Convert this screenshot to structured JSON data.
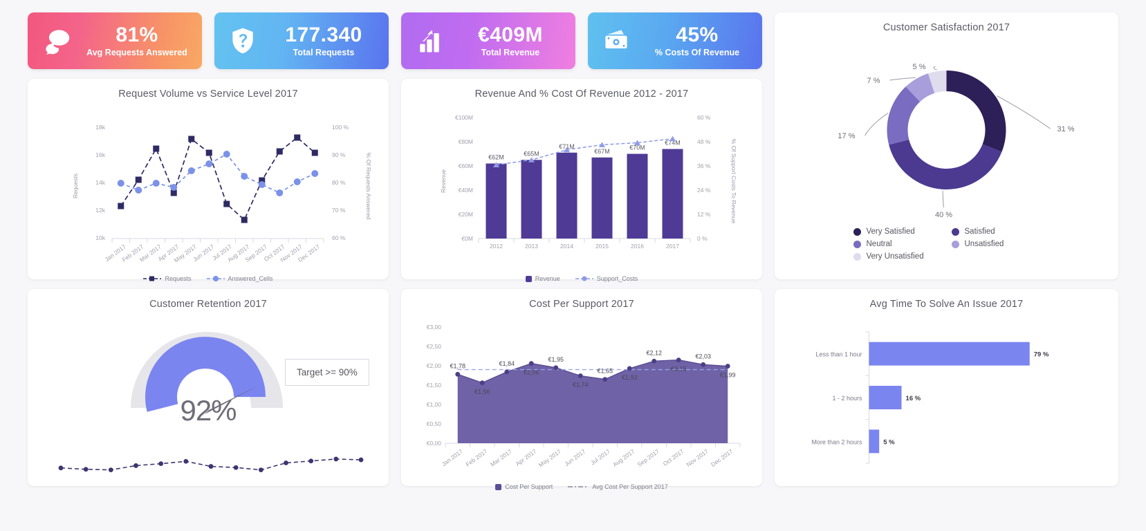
{
  "kpis": [
    {
      "icon": "chat-bubbles-icon",
      "value": "81%",
      "label": "Avg Requests Answered"
    },
    {
      "icon": "shield-question-icon",
      "value": "177.340",
      "label": "Total Requests"
    },
    {
      "icon": "bar-chart-up-icon",
      "value": "€409M",
      "label": "Total Revenue"
    },
    {
      "icon": "money-banknote-icon",
      "value": "45%",
      "label": "% Costs Of Revenue"
    }
  ],
  "chart_data": [
    {
      "id": "request_volume",
      "type": "line",
      "title": "Request Volume vs Service Level 2017",
      "xlabel": "",
      "ylabel": "Requests",
      "y2label": "% Of Requests Answered",
      "categories": [
        "Jan 2017",
        "Feb 2017",
        "Mar 2017",
        "Apr 2017",
        "May 2017",
        "Jun 2017",
        "Jul 2017",
        "Aug 2017",
        "Sep 2017",
        "Oct 2017",
        "Nov 2017",
        "Dec 2017"
      ],
      "ytick_labels": [
        "10k",
        "12k",
        "14k",
        "16k",
        "18k"
      ],
      "ylim": [
        10000,
        18000
      ],
      "y2tick_labels": [
        "60 %",
        "70 %",
        "80 %",
        "90 %",
        "100 %"
      ],
      "y2lim": [
        60,
        100
      ],
      "grid": false,
      "legend_position": "bottom",
      "series": [
        {
          "name": "Requests",
          "axis": "left",
          "color": "#2e2a63",
          "values": [
            12350,
            14250,
            16500,
            13300,
            17200,
            16200,
            12500,
            11350,
            14200,
            16300,
            17300,
            16200
          ]
        },
        {
          "name": "Answered_Cells",
          "axis": "right",
          "color": "#7b92e8",
          "values": [
            80.0,
            77.5,
            80.0,
            78.5,
            84.5,
            87.0,
            90.5,
            82.5,
            79.5,
            76.5,
            80.5,
            83.5
          ]
        }
      ]
    },
    {
      "id": "revenue_cost",
      "type": "bar",
      "title": "Revenue And % Cost Of Revenue 2012 - 2017",
      "ylabel": "Revenue",
      "y2label": "% Of Support Costs To Revenue",
      "categories": [
        "2012",
        "2013",
        "2014",
        "2015",
        "2016",
        "2017"
      ],
      "ytick_labels": [
        "€0M",
        "€20M",
        "€40M",
        "€60M",
        "€80M",
        "€100M"
      ],
      "ylim": [
        0,
        100
      ],
      "y2tick_labels": [
        "0 %",
        "12 %",
        "24 %",
        "36 %",
        "48 %",
        "60 %"
      ],
      "y2lim": [
        0,
        60
      ],
      "legend_position": "bottom",
      "series": [
        {
          "name": "Revenue",
          "type": "bar",
          "color": "#4f3a96",
          "values": [
            62,
            65,
            71,
            67,
            70,
            74
          ],
          "labels": [
            "€62M",
            "€65M",
            "€71M",
            "€67M",
            "€70M",
            "€74M"
          ]
        },
        {
          "name": "Support_Costs",
          "type": "line",
          "axis": "right",
          "color": "#8f9ae8",
          "values": [
            36.5,
            39.0,
            44.0,
            46.5,
            47.5,
            49.5
          ]
        }
      ]
    },
    {
      "id": "customer_satisfaction",
      "type": "pie",
      "title": "Customer Satisfaction 2017",
      "labels": [
        "Very Satisfied",
        "Satisfied",
        "Neutral",
        "Unsatisfied",
        "Very Unsatisfied"
      ],
      "values": [
        31,
        40,
        17,
        7,
        5
      ],
      "value_labels": [
        "31 %",
        "40 %",
        "17 %",
        "7 %",
        "5 %"
      ],
      "colors": [
        "#2d1f57",
        "#4b3a90",
        "#7a6cc0",
        "#a79edb",
        "#dedced"
      ],
      "legend_position": "bottom"
    },
    {
      "id": "customer_retention",
      "type": "gauge",
      "title": "Customer Retention 2017",
      "value": 92,
      "value_label": "92%",
      "target_label": "Target >=  90%",
      "gauge_color": "#7b85f0",
      "gauge_track_color": "#e6e6ea",
      "spark_label": "",
      "spark_values": [
        40,
        33,
        30,
        52,
        62,
        74,
        48,
        42,
        30,
        66,
        76,
        86,
        82
      ],
      "spark_color": "#3d3570"
    },
    {
      "id": "cost_per_support",
      "type": "area",
      "title": "Cost Per Support 2017",
      "categories": [
        "Jan 2017",
        "Feb 2017",
        "Mar 2017",
        "Apr 2017",
        "May 2017",
        "Jun 2017",
        "Jul 2017",
        "Aug 2017",
        "Sep 2017",
        "Oct 2017",
        "Nov 2017",
        "Dec 2017"
      ],
      "ytick_labels": [
        "€0,00",
        "€0,50",
        "€1,00",
        "€1,50",
        "€2,00",
        "€2,50",
        "€3,00"
      ],
      "ylim": [
        0,
        3
      ],
      "legend_position": "bottom",
      "series": [
        {
          "name": "Cost Per Support",
          "type": "area",
          "color": "#6f62a6",
          "values": [
            1.78,
            1.56,
            1.84,
            2.06,
            1.95,
            1.74,
            1.65,
            1.93,
            2.12,
            2.15,
            2.03,
            1.99
          ],
          "labels": [
            "€1,78",
            "€1,56",
            "€1,84",
            "€2,06",
            "€1,95",
            "€1,74",
            "€1,65",
            "€1,93",
            "€2,12",
            "€2,15",
            "€2,03",
            "€1,99"
          ]
        },
        {
          "name": "Avg Cost Per Support 2017",
          "type": "line",
          "color": "#8f9ae8",
          "values": [
            1.9,
            1.9,
            1.9,
            1.9,
            1.9,
            1.9,
            1.9,
            1.9,
            1.9,
            1.9,
            1.9,
            1.9
          ]
        }
      ]
    },
    {
      "id": "avg_time_to_solve",
      "type": "bar",
      "orientation": "horizontal",
      "title": "Avg Time To Solve An Issue  2017",
      "categories": [
        "Less than 1 hour",
        "1 - 2 hours",
        "More than 2 hours"
      ],
      "values": [
        79,
        16,
        5
      ],
      "value_labels": [
        "79 %",
        "16 %",
        "5 %"
      ],
      "bar_color": "#7b85f0",
      "xlim": [
        0,
        100
      ]
    }
  ]
}
